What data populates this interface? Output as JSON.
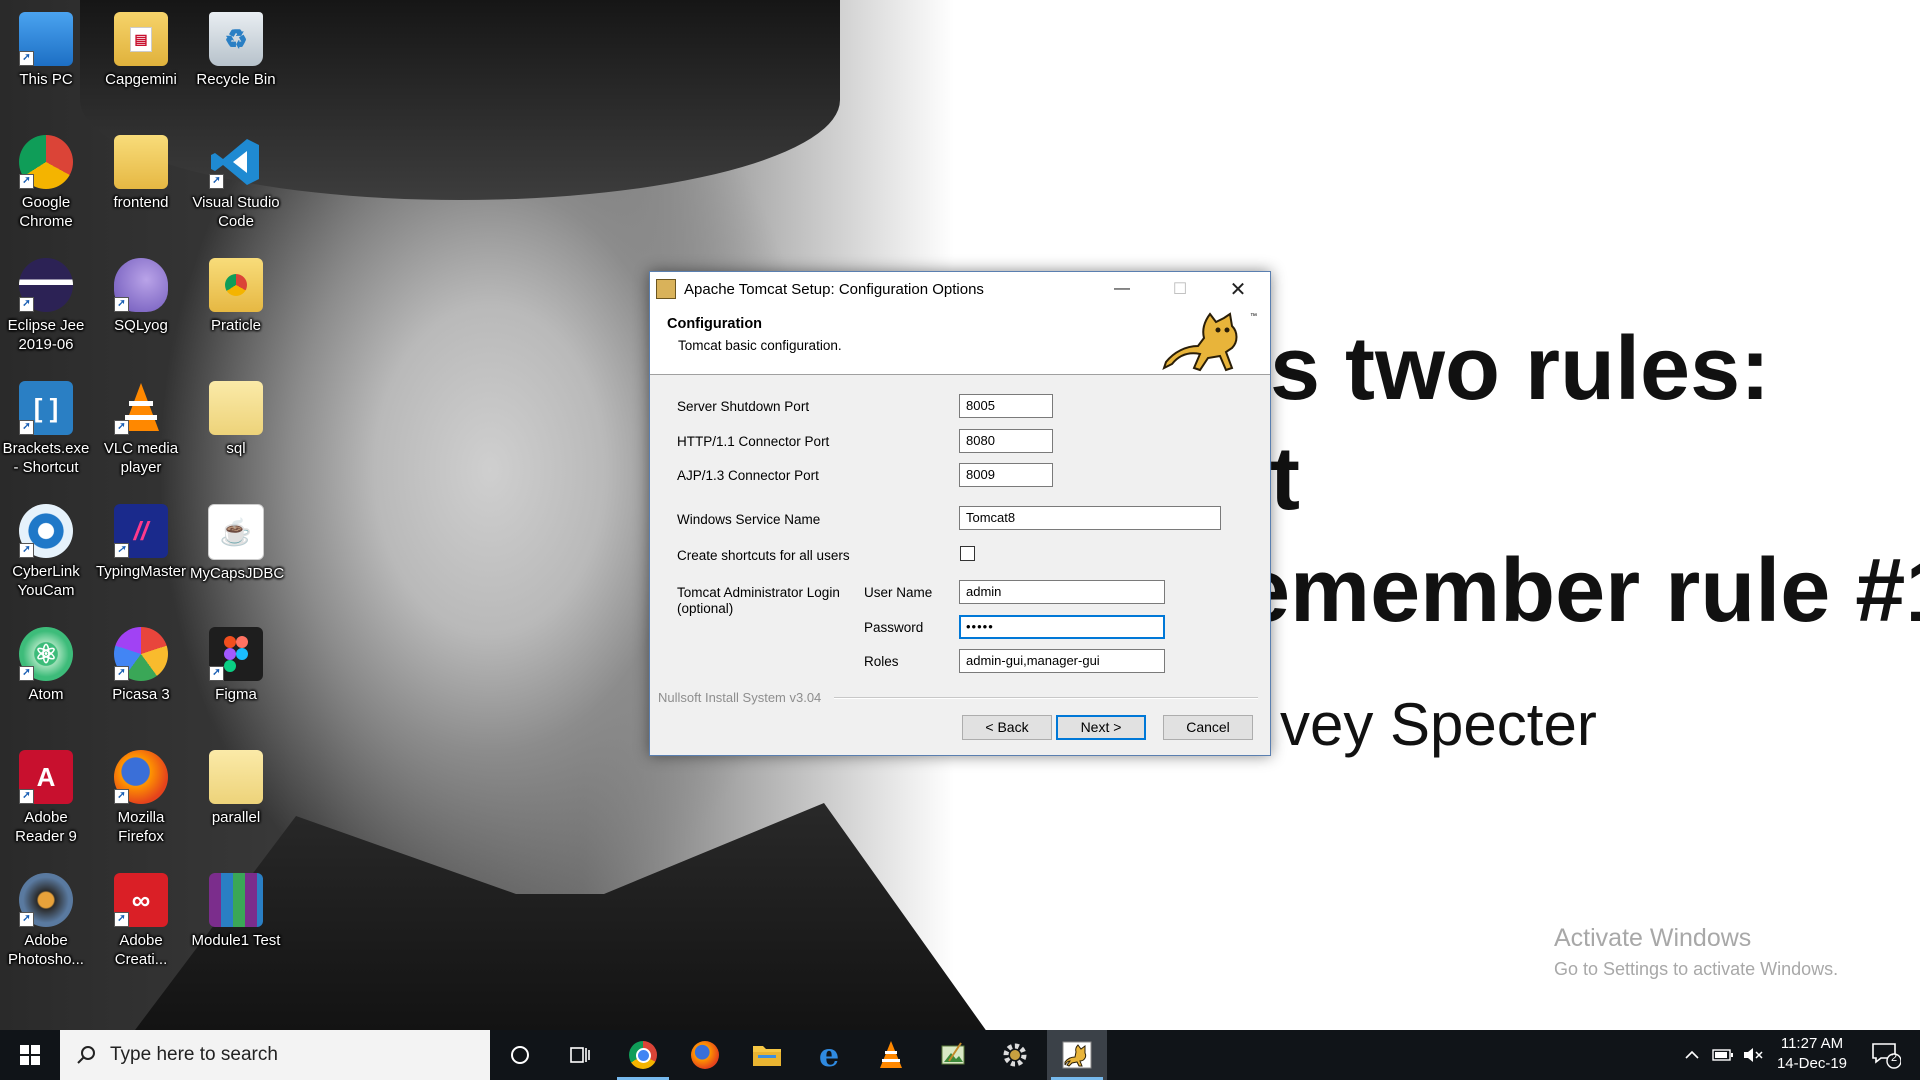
{
  "desktop": {
    "wall_lines": [
      "s two rules:",
      "t",
      "emember rule #1",
      "vey Specter"
    ],
    "activate": {
      "title": "Activate Windows",
      "subtitle": "Go to Settings to activate Windows."
    },
    "icons": [
      {
        "label": "This PC",
        "icon": "monitor-icon"
      },
      {
        "label": "Capgemini",
        "icon": "pdf-folder-icon"
      },
      {
        "label": "Recycle Bin",
        "icon": "recycle-bin-icon"
      },
      {
        "label": "Google Chrome",
        "icon": "chrome-icon"
      },
      {
        "label": "frontend",
        "icon": "folder-icon"
      },
      {
        "label": "Visual Studio Code",
        "icon": "vscode-icon"
      },
      {
        "label": "Eclipse Jee 2019-06",
        "icon": "eclipse-icon"
      },
      {
        "label": "SQLyog",
        "icon": "dolphin-icon"
      },
      {
        "label": "Praticle",
        "icon": "chrome-folder-icon"
      },
      {
        "label": "Brackets.exe - Shortcut",
        "icon": "brackets-icon"
      },
      {
        "label": "VLC media player",
        "icon": "vlc-icon"
      },
      {
        "label": "sql",
        "icon": "folder-icon"
      },
      {
        "label": "CyberLink YouCam",
        "icon": "webcam-icon"
      },
      {
        "label": "TypingMaster",
        "icon": "typingmaster-icon"
      },
      {
        "label": "MyCapsJDBC",
        "icon": "java-icon"
      },
      {
        "label": "Atom",
        "icon": "atom-icon"
      },
      {
        "label": "Picasa 3",
        "icon": "picasa-icon"
      },
      {
        "label": "Figma",
        "icon": "figma-icon"
      },
      {
        "label": "Adobe Reader 9",
        "icon": "acrobat-icon"
      },
      {
        "label": "Mozilla Firefox",
        "icon": "firefox-icon"
      },
      {
        "label": "parallel",
        "icon": "folder-icon"
      },
      {
        "label": "Adobe Photosho...",
        "icon": "photoshop-icon"
      },
      {
        "label": "Adobe Creati...",
        "icon": "creative-cloud-icon"
      },
      {
        "label": "Module1 Test",
        "icon": "winrar-icon"
      }
    ]
  },
  "dialog": {
    "title": "Apache Tomcat Setup: Configuration Options",
    "header_title": "Configuration",
    "header_subtitle": "Tomcat basic configuration.",
    "fields": {
      "shutdown_port": {
        "label": "Server Shutdown Port",
        "value": "8005"
      },
      "http_port": {
        "label": "HTTP/1.1 Connector Port",
        "value": "8080"
      },
      "ajp_port": {
        "label": "AJP/1.3 Connector Port",
        "value": "8009"
      },
      "service_name": {
        "label": "Windows Service Name",
        "value": "Tomcat8"
      },
      "shortcuts": {
        "label": "Create shortcuts for all users",
        "checked": false
      },
      "admin_login_label": "Tomcat Administrator Login",
      "admin_login_optional": "(optional)",
      "username": {
        "label": "User Name",
        "value": "admin"
      },
      "password": {
        "label": "Password",
        "value": "•••••"
      },
      "roles": {
        "label": "Roles",
        "value": "admin-gui,manager-gui"
      }
    },
    "footer_brand": "Nullsoft Install System v3.04",
    "buttons": {
      "back": "< Back",
      "next": "Next >",
      "cancel": "Cancel"
    }
  },
  "taskbar": {
    "search_placeholder": "Type here to search",
    "time": "11:27 AM",
    "date": "14-Dec-19",
    "notification_count": "2",
    "accent": "#76b9ed"
  }
}
